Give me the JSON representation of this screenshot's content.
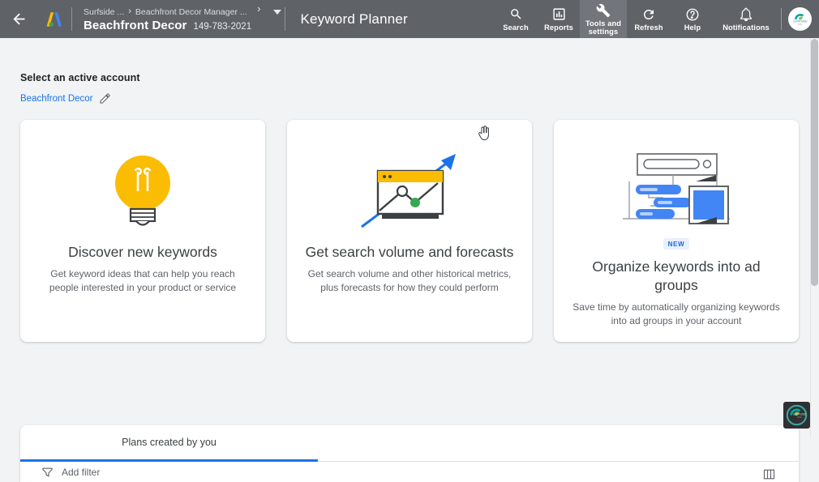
{
  "topbar": {
    "back_icon": "arrow-left-icon",
    "logo_icon": "google-ads-logo-icon",
    "breadcrumbs": [
      {
        "label": "Surfside ..."
      },
      {
        "label": "Beachfront Decor Manager ..."
      }
    ],
    "breadcrumb_separator": "›",
    "account_name": "Beachfront Decor",
    "account_id": "149-783-2021",
    "page_title": "Keyword Planner",
    "actions": [
      {
        "label": "Search",
        "icon": "search-icon",
        "active": false
      },
      {
        "label": "Reports",
        "icon": "bar-chart-icon",
        "active": false
      },
      {
        "label": "Tools and settings",
        "icon": "wrench-icon",
        "active": true
      },
      {
        "label": "Refresh",
        "icon": "refresh-icon",
        "active": false
      },
      {
        "label": "Help",
        "icon": "help-circle-icon",
        "active": false
      },
      {
        "label": "Notifications",
        "icon": "bell-icon",
        "active": false
      }
    ],
    "avatar_icon": "account-avatar"
  },
  "account_section": {
    "heading": "Select an active account",
    "account_link": "Beachfront Decor",
    "edit_icon": "pencil-icon"
  },
  "cards": [
    {
      "art_icon": "lightbulb-illustration",
      "badge": "",
      "title": "Discover new keywords",
      "description": "Get keyword ideas that can help you reach people interested in your product or service"
    },
    {
      "art_icon": "chart-forecast-illustration",
      "badge": "",
      "title": "Get search volume and forecasts",
      "description": "Get search volume and other historical metrics, plus forecasts for how they could perform"
    },
    {
      "art_icon": "ad-groups-illustration",
      "badge": "NEW",
      "title": "Organize keywords into ad groups",
      "description": "Save time by automatically organizing keywords into ad groups in your account"
    }
  ],
  "bottom_panel": {
    "tabs": [
      {
        "label": "Plans created by you",
        "active": true
      }
    ],
    "filter_icon": "filter-icon",
    "filter_label": "Add filter",
    "table_icon": "table-columns-icon"
  },
  "cursor": {
    "icon": "pointer-hand-cursor"
  },
  "watermark": {
    "icon": "surfside-ppc-logo"
  },
  "colors": {
    "topbar_bg": "#5f6368",
    "topbar_active": "#72767c",
    "page_bg": "#f1f3f4",
    "card_bg": "#ffffff",
    "accent_blue": "#1a73e8",
    "badge_bg": "#e8f0fe",
    "badge_text": "#1967d2",
    "link_blue": "#1a73e8",
    "text_primary": "#202124",
    "text_secondary": "#5f6368",
    "bulb_yellow": "#fbbc04",
    "chart_green": "#34a853"
  }
}
